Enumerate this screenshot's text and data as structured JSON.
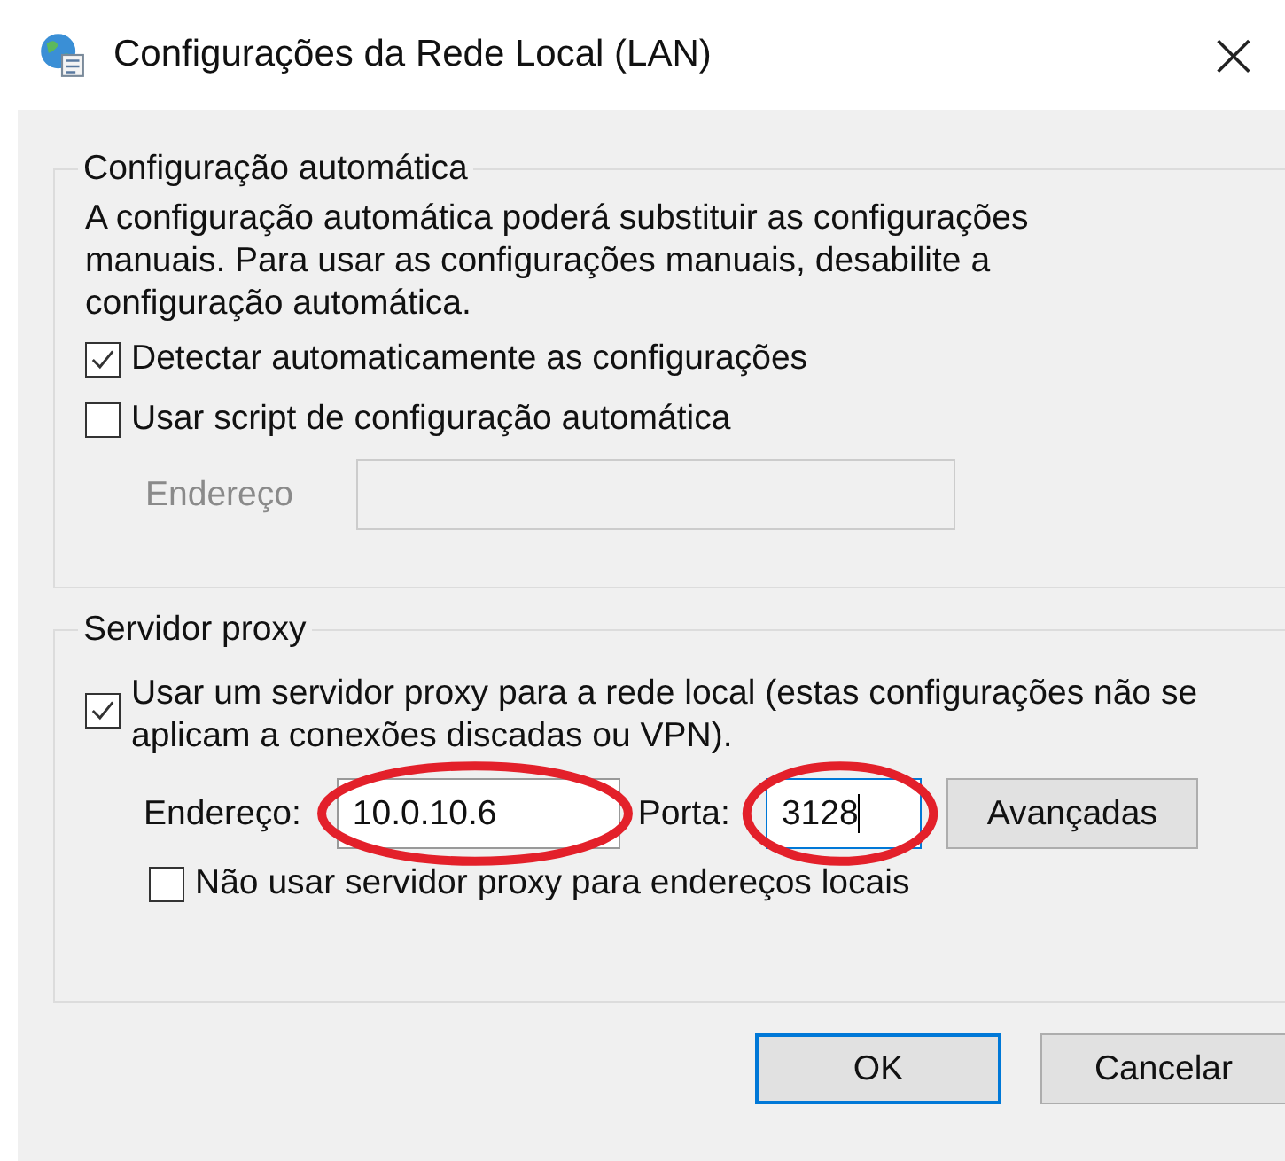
{
  "window": {
    "title": "Configurações da Rede Local (LAN)",
    "close": "×"
  },
  "automatic": {
    "legend": "Configuração automática",
    "description": "A configuração automática poderá substituir as configurações manuais. Para usar as configurações manuais, desabilite a configuração automática.",
    "options": [
      {
        "label": "Detectar automaticamente as configurações",
        "checked": true
      },
      {
        "label": "Usar script de configuração automática",
        "checked": false
      }
    ],
    "address": {
      "label": "Endereço",
      "disabled": true
    }
  },
  "proxy": {
    "legend": "Servidor proxy",
    "use_proxy": {
      "label": "Usar um servidor proxy para a rede local (estas configurações não se aplicam a conexões discadas ou VPN).",
      "checked": true
    },
    "address": {
      "label": "Endereço:",
      "value": "10.0.10.6",
      "highlighted": true,
      "focused": false
    },
    "port": {
      "label": "Porta:",
      "value": "3128",
      "highlighted": true,
      "focused": true
    },
    "advanced": "Avançadas",
    "bypass": {
      "label": "Não usar servidor proxy para endereços locais",
      "checked": false
    }
  },
  "buttons": [
    {
      "label": "OK",
      "default": true
    },
    {
      "label": "Cancelar",
      "default": false
    }
  ]
}
